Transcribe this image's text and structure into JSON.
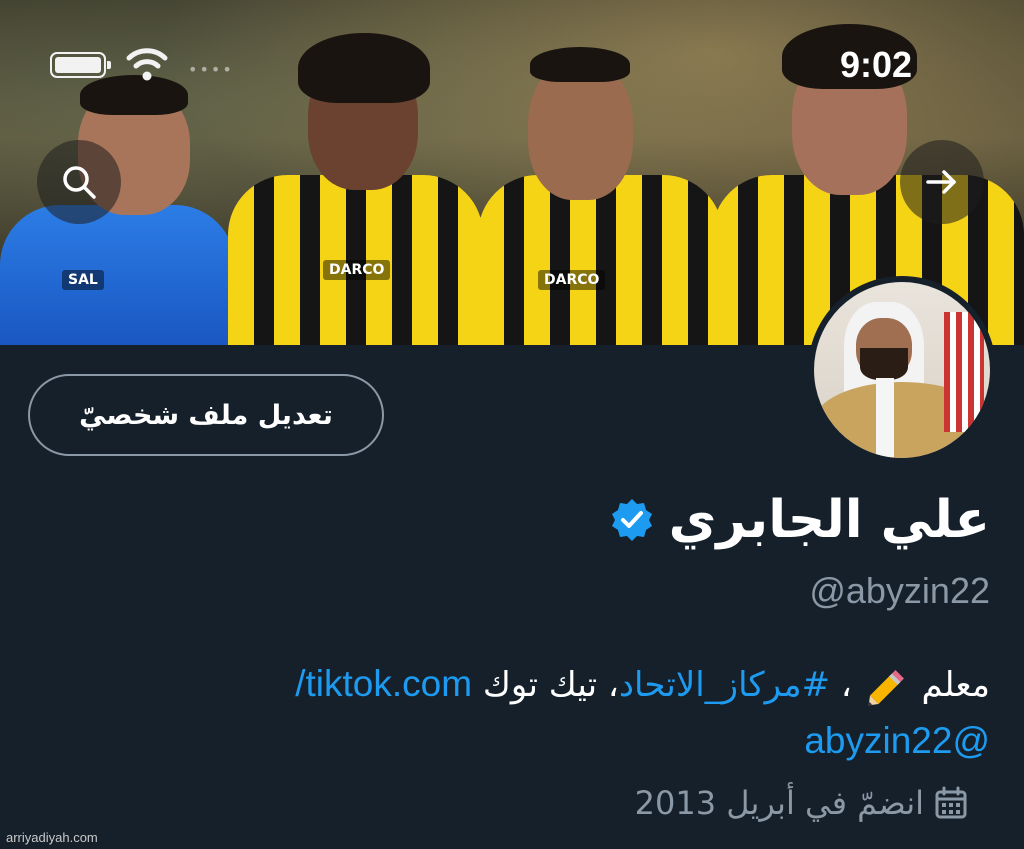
{
  "status_bar": {
    "time": "9:02"
  },
  "profile": {
    "edit_button_label": "تعديل ملف شخصيّ",
    "display_name": "علي الجابري",
    "handle": "@abyzin22",
    "verified": true,
    "bio": {
      "prefix": "معلم",
      "comma1": "،",
      "hashtag": "#مركاز_الاتحاد",
      "comma2": "،",
      "middle": "تيك توك",
      "url": "tiktok.com/",
      "url_handle": "@abyzin22"
    },
    "joined": "انضمّ في أبريل 2013"
  },
  "banner": {
    "sponsor_1": "SAL",
    "sponsor_2": "DARCO"
  },
  "watermark": "arriyadiyah.com",
  "colors": {
    "background": "#15202b",
    "link": "#1d9bf0",
    "verified_badge": "#1d9bf0",
    "muted_text": "#8b98a5"
  },
  "icons": {
    "search": "search-icon",
    "forward": "arrow-right-icon",
    "verified": "verified-badge-icon",
    "pencil": "pencil-emoji-icon",
    "calendar": "calendar-icon"
  }
}
